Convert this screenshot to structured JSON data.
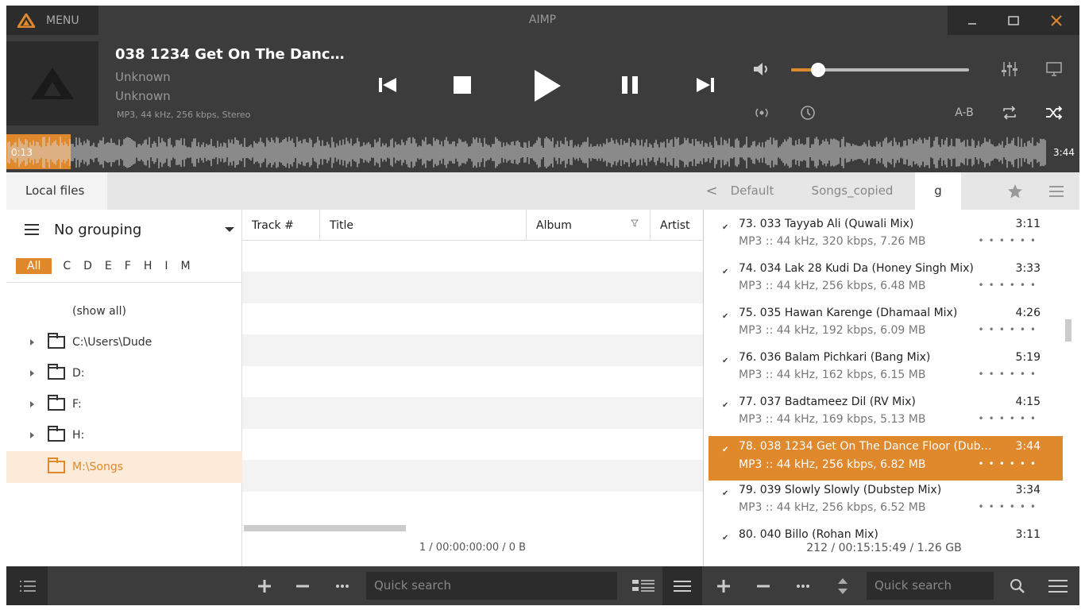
{
  "titlebar": {
    "menu_label": "MENU",
    "app_title": "AIMP"
  },
  "now_playing": {
    "title": "038 1234 Get On The Danc…",
    "artist": "Unknown",
    "album": "Unknown",
    "format_info": "MP3, 44 kHz, 256 kbps, Stereo"
  },
  "player": {
    "volume": 0.15
  },
  "waveform": {
    "elapsed": "0:13",
    "total": "3:44",
    "progress": 0.06
  },
  "extras": {
    "ab_label": "A-B"
  },
  "tabs": {
    "local_files": "Local files",
    "playlists": [
      "Default",
      "Songs_copied",
      "g"
    ],
    "back_arrow": "<"
  },
  "library": {
    "grouping": "No grouping",
    "letters": [
      "All",
      "C",
      "D",
      "E",
      "F",
      "H",
      "I",
      "M"
    ],
    "show_all": "(show all)",
    "folders": [
      "C:\\Users\\Dude",
      "D:",
      "F:",
      "H:",
      "M:\\Songs"
    ]
  },
  "table": {
    "columns": [
      "Track #",
      "Title",
      "Album",
      "Artist"
    ],
    "status": "1 / 00:00:00:00 / 0 B"
  },
  "playlist": {
    "items": [
      {
        "title": "73. 033 Tayyab Ali (Quwali Mix)",
        "duration": "3:11",
        "info": "MP3 :: 44 kHz, 320 kbps, 7.26 MB"
      },
      {
        "title": "74. 034  Lak 28 Kudi Da (Honey Singh Mix)",
        "duration": "3:33",
        "info": "MP3 :: 44 kHz, 256 kbps, 6.48 MB"
      },
      {
        "title": "75. 035 Hawan Karenge (Dhamaal Mix)",
        "duration": "4:26",
        "info": "MP3 :: 44 kHz, 192 kbps, 6.09 MB"
      },
      {
        "title": "76. 036 Balam Pichkari (Bang Mix)",
        "duration": "5:19",
        "info": "MP3 :: 44 kHz, 162 kbps, 6.15 MB"
      },
      {
        "title": "77. 037 Badtameez Dil (RV Mix)",
        "duration": "4:15",
        "info": "MP3 :: 44 kHz, 169 kbps, 5.13 MB"
      },
      {
        "title": "78. 038 1234 Get On The Dance Floor (Dub…",
        "duration": "3:44",
        "info": "MP3 :: 44 kHz, 256 kbps, 6.82 MB"
      },
      {
        "title": "79. 039 Slowly Slowly (Dubstep Mix)",
        "duration": "3:34",
        "info": "MP3 :: 44 kHz, 256 kbps, 6.52 MB"
      },
      {
        "title": "80. 040 Billo (Rohan Mix)",
        "duration": "3:11",
        "info": ""
      }
    ],
    "status": "212 / 00:15:15:49 / 1.26 GB"
  },
  "search": {
    "left_placeholder": "Quick search",
    "right_placeholder": "Quick search"
  },
  "colors": {
    "accent": "#e0882c",
    "bar": "#3c3c3c",
    "dark": "#2c2c2c"
  }
}
